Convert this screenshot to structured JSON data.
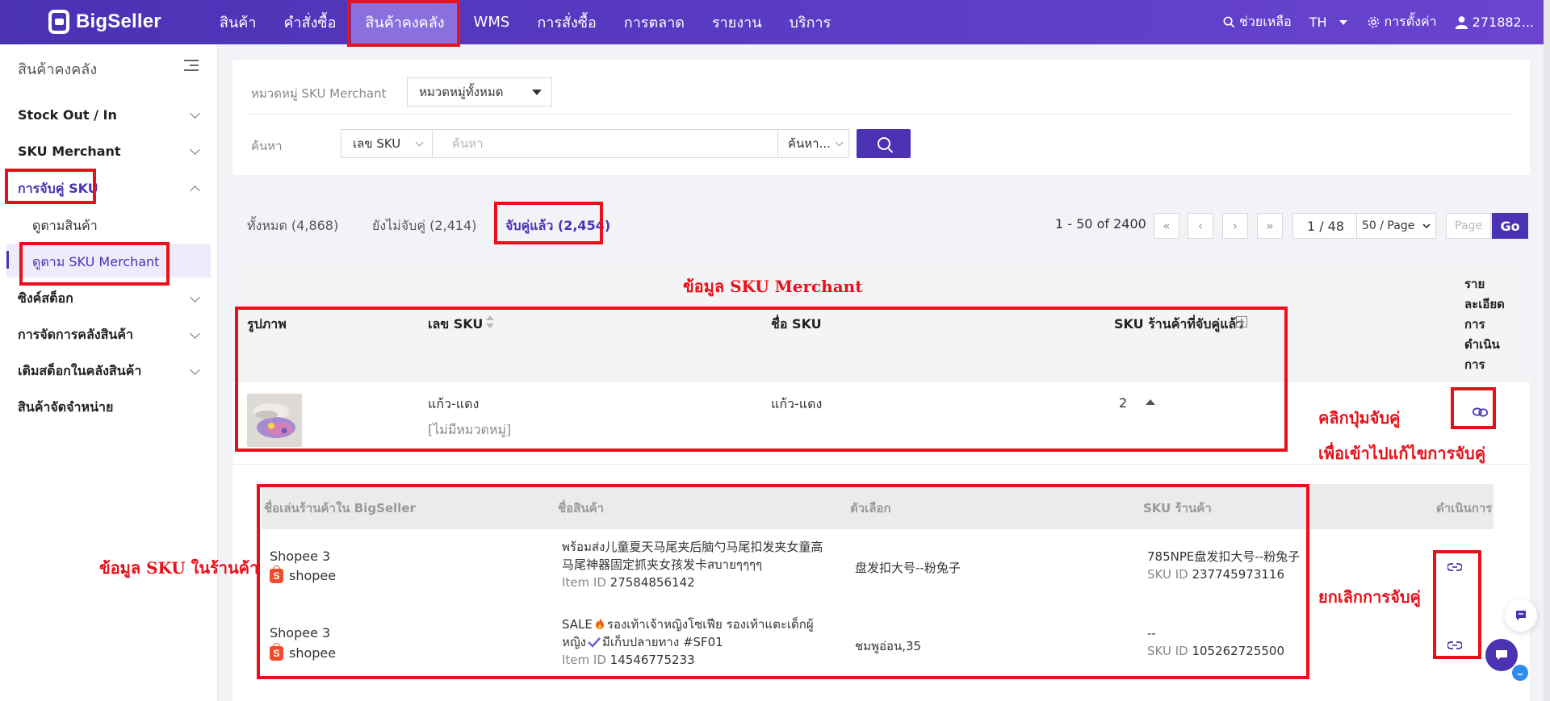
{
  "app": {
    "logo_text": "BigSeller"
  },
  "topnav": {
    "items": [
      "สินค้า",
      "คำสั่งซื้อ",
      "สินค้าคงคลัง",
      "WMS",
      "การสั่งซื้อ",
      "การตลาด",
      "รายงาน",
      "บริการ"
    ],
    "help": "ช่วยเหลือ",
    "lang": "TH",
    "settings": "การตั้งค่า",
    "user": "271882..."
  },
  "sidebar": {
    "title": "สินค้าคงคลัง",
    "items": [
      {
        "label": "Stock Out / In"
      },
      {
        "label": "SKU Merchant"
      },
      {
        "label": "การจับคู่ SKU",
        "sub": [
          "ดูตามสินค้า",
          "ดูตาม SKU Merchant"
        ]
      },
      {
        "label": "ซิงค์สต็อก"
      },
      {
        "label": "การจัดการคลังสินค้า"
      },
      {
        "label": "เติมสต็อกในคลังสินค้า"
      },
      {
        "label": "สินค้าจัดจำหน่าย"
      }
    ]
  },
  "filters": {
    "category_label": "หมวดหมู่ SKU Merchant",
    "category_value": "หมวดหมู่ทั้งหมด",
    "search_label": "ค้นหา",
    "search_field": "เลข SKU",
    "search_placeholder": "ค้นหา",
    "search_mode": "ค้นหา..."
  },
  "tabs": [
    "ทั้งหมด (4,868)",
    "ยังไม่จับคู่ (2,414)",
    "จับคู่แล้ว (2,454)"
  ],
  "pagination": {
    "range": "1 - 50 of 2400",
    "first": "«",
    "prev": "‹",
    "next": "›",
    "last": "»",
    "page": "1 / 48",
    "page_size": "50 / Page",
    "page_placeholder": "Page",
    "go": "Go"
  },
  "table": {
    "headers": [
      "รูปภาพ",
      "เลข SKU",
      "ชื่อ SKU",
      "SKU ร้านค้าที่จับคู่แล้ว"
    ],
    "action_header": [
      "ราย",
      "ละเอียด",
      "การ",
      "ดำเนิน",
      "การ"
    ],
    "row": {
      "sku_no": "แก้ว-แดง",
      "category": "[ไม่มีหมวดหมู่]",
      "sku_name": "แก้ว-แดง",
      "matched_count": "2"
    }
  },
  "subtable": {
    "headers": [
      "ชื่อเล่นร้านค้าใน BigSeller",
      "ชื่อสินค้า",
      "ตัวเลือก",
      "SKU ร้านค้า",
      "ดำเนินการ"
    ],
    "rows": [
      {
        "shop": "Shopee 3",
        "platform": "shopee",
        "name_l1": "พร้อมส่ง儿童夏天马尾夹后脑勺马尾扣发夹女童高",
        "name_l2": "马尾神器固定抓夹女孩发卡สบายๆๆๆๆ",
        "item_id_label": "Item ID",
        "item_id": "27584856142",
        "variant": "盘发扣大号--粉兔子",
        "shop_sku": "785NPE盘发扣大号--粉兔子",
        "sku_id_label": "SKU ID",
        "sku_id": "237745973116"
      },
      {
        "shop": "Shopee 3",
        "platform": "shopee",
        "name_l1a": "SALE",
        "name_l1b": "รองเท้าเจ้าหญิงโซเฟีย รองเท้าแตะเด็กผู้",
        "name_l2a": "หญิง",
        "name_l2b": "มีเก็บปลายทาง #SF01",
        "item_id_label": "Item ID",
        "item_id": "14546775233",
        "variant": "ชมพูอ่อน,35",
        "shop_sku": "--",
        "sku_id_label": "SKU ID",
        "sku_id": "105262725500"
      }
    ]
  },
  "annotations": {
    "merchant_title": "ข้อมูล SKU Merchant",
    "click_pair_1": "คลิกปุ่มจับคู่",
    "click_pair_2": "เพื่อเข้าไปแก้ไขการจับคู่",
    "store_info": "ข้อมูล SKU ในร้านค้า",
    "cancel_pair": "ยกเลิกการจับคู่"
  },
  "colors": {
    "brand": "#4a32b3",
    "annotation_red": "#e8101a",
    "shopee": "#ee4d2d"
  }
}
